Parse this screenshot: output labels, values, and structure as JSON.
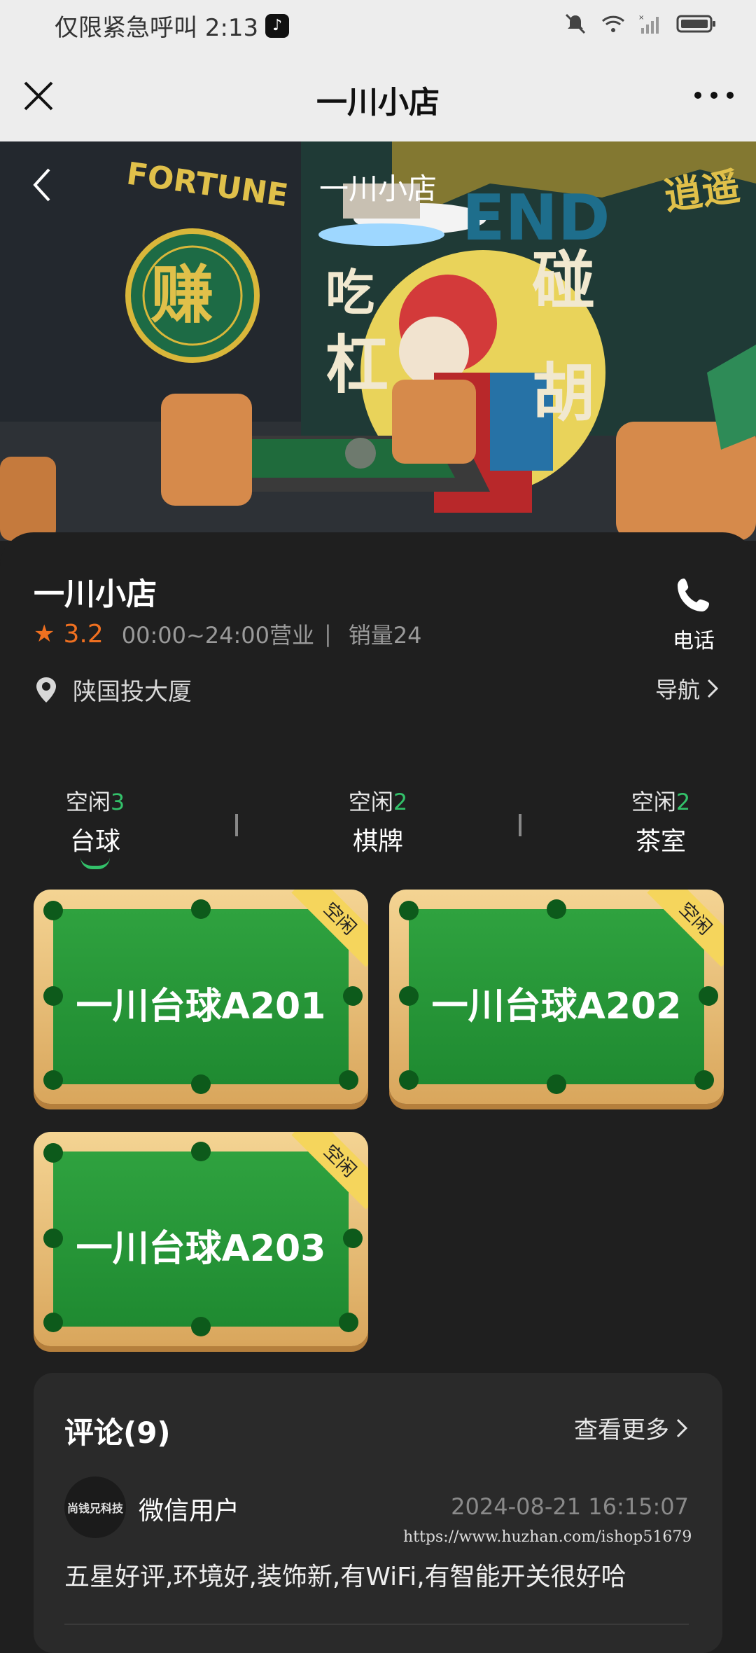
{
  "status_bar": {
    "left_text": "仅限紧急呼叫 2:13",
    "icons": [
      "tiktok-icon",
      "bell-off-icon",
      "wifi-icon",
      "signal-off-icon",
      "battery-icon"
    ]
  },
  "title_bar": {
    "title": "一川小店"
  },
  "hero": {
    "title": "一川小店"
  },
  "shop": {
    "name": "一川小店",
    "score": "3.2",
    "hours": "00:00~24:00营业",
    "sales": "销量24",
    "phone_label": "电话",
    "address": "陕国投大厦",
    "nav_label": "导航"
  },
  "tabs": [
    {
      "free_label": "空闲",
      "free_count": "3",
      "name": "台球"
    },
    {
      "free_label": "空闲",
      "free_count": "2",
      "name": "棋牌"
    },
    {
      "free_label": "空闲",
      "free_count": "2",
      "name": "茶室"
    }
  ],
  "active_tab": "台球",
  "tables": [
    {
      "name": "一川台球A201",
      "status": "空闲"
    },
    {
      "name": "一川台球A202",
      "status": "空闲"
    },
    {
      "name": "一川台球A203",
      "status": "空闲"
    }
  ],
  "comments": {
    "title": "评论(9)",
    "more_label": "查看更多",
    "items": [
      {
        "avatar_text": "尚钱兄科技",
        "user": "微信用户",
        "time": "2024-08-21 16:15:07",
        "text": "五星好评,环境好,装饰新,有WiFi,有智能开关很好哈"
      }
    ]
  },
  "watermark": "https://www.huzhan.com/ishop51679",
  "colors": {
    "accent_green": "#33c16a",
    "rating_orange": "#f07020",
    "felt_green": "#2fa23f",
    "rail_gold": "#e9c07a"
  }
}
